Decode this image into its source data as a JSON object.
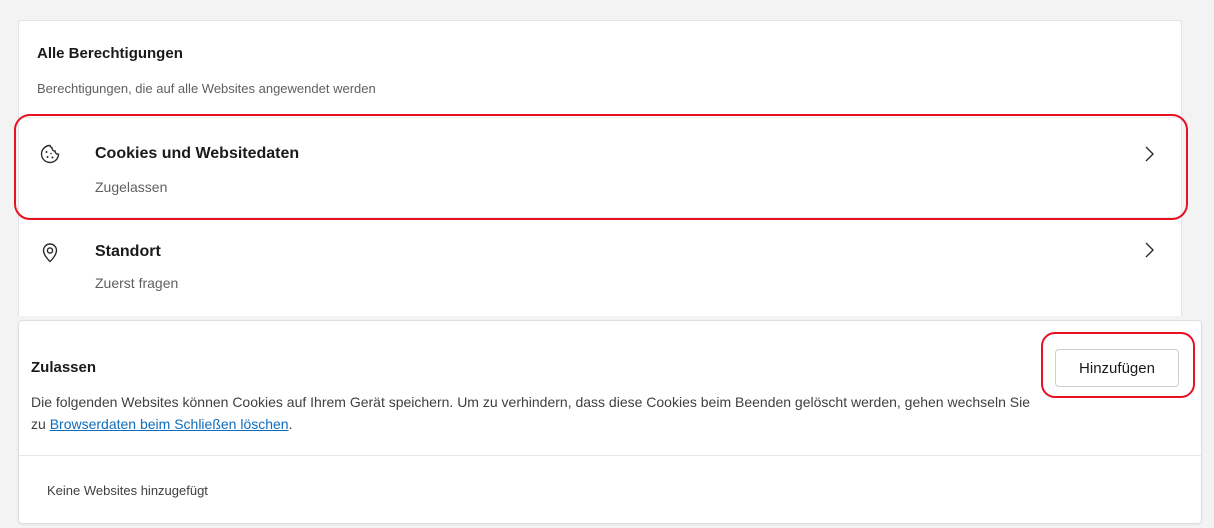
{
  "permissions": {
    "title": "Alle Berechtigungen",
    "subtitle": "Berechtigungen, die auf alle Websites angewendet werden",
    "items": [
      {
        "label": "Cookies und Websitedaten",
        "value": "Zugelassen",
        "icon": "cookie-icon"
      },
      {
        "label": "Standort",
        "value": "Zuerst fragen",
        "icon": "location-icon"
      }
    ]
  },
  "allow": {
    "title": "Zulassen",
    "desc_prefix": "Die folgenden Websites können Cookies auf Ihrem Gerät speichern. Um zu verhindern, dass diese Cookies beim Beenden gelöscht werden, gehen wechseln Sie zu ",
    "desc_link": "Browserdaten beim Schließen löschen",
    "desc_suffix": ".",
    "add_button": "Hinzufügen",
    "empty_text": "Keine Websites hinzugefügt"
  },
  "colors": {
    "highlight": "#e81123",
    "link": "#0f6cbd"
  }
}
